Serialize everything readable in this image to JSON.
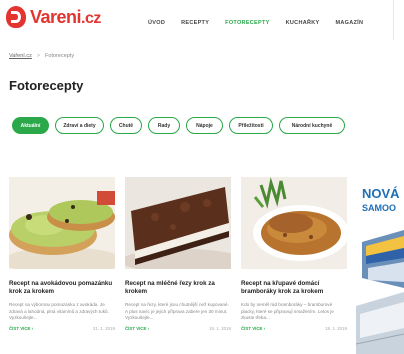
{
  "brand": {
    "name": "Vareni",
    "tld": ".cz"
  },
  "nav": {
    "items": [
      "ÚVOD",
      "RECEPTY",
      "FOTORECEPTY",
      "KUCHAŘKY",
      "MAGAZÍN"
    ],
    "active_index": 2
  },
  "breadcrumb": {
    "home": "Vaření.cz",
    "current": "Fotorecepty"
  },
  "page": {
    "title": "Fotorecepty"
  },
  "tabs": [
    {
      "label": "Aktuální",
      "active": true
    },
    {
      "label": "Zdraví a diety",
      "active": false
    },
    {
      "label": "Chutě",
      "active": false
    },
    {
      "label": "Rady",
      "active": false
    },
    {
      "label": "Nápoje",
      "active": false
    },
    {
      "label": "Příležitosti",
      "active": false
    },
    {
      "label": "Národní kuchyně",
      "active": false
    }
  ],
  "cards": [
    {
      "title": "Recept na avokádovou pomazánku krok za krokem",
      "description": "Recept na výbornou pomazánku z avokáda. Je zdravá a lahodná, plná vitamínů a zdravých tuků. Vyzkoušejte...",
      "read_label": "ČÍST VÍCE",
      "date": "21. 1. 2019"
    },
    {
      "title": "Recept na mléčné řezy krok za krokem",
      "description": "Recept na řezy, které jsou chutnější než kupované. A plus navíc je jejich příprava zabere jen 30 minut. Vyzkoušejte...",
      "read_label": "ČÍST VÍCE",
      "date": "19. 1. 2019"
    },
    {
      "title": "Recept na křupavé domácí bramboráky krok za krokem",
      "description": "Kdo by neměl rád bramboráky – bramborové placky, které se připravují smažením. Letos je zkuste třeba...",
      "read_label": "ČÍST VÍCE",
      "date": "18. 1. 2019"
    }
  ],
  "ad": {
    "line1": "NOVÁ",
    "line2": "SAMOO"
  },
  "colors": {
    "accent": "#2aa84a",
    "brand": "#e3342f",
    "ad_blue": "#1f6fb5"
  }
}
